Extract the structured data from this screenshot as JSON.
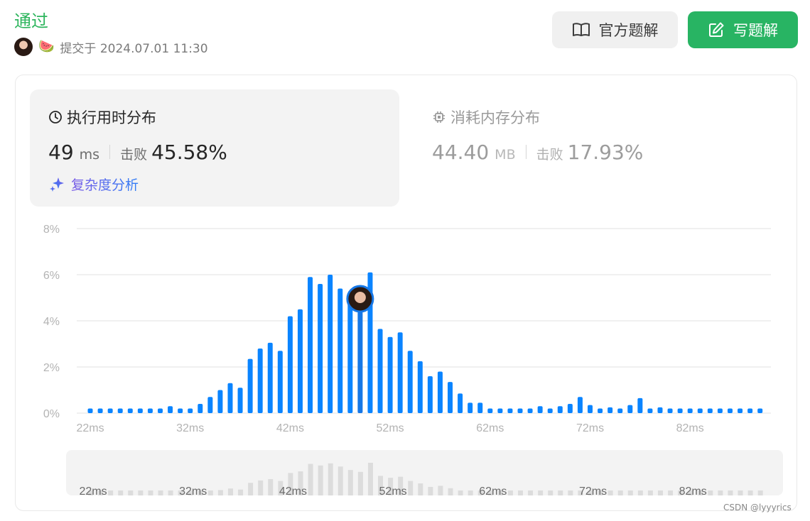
{
  "header": {
    "status": "通过",
    "submit_badge": "🍉",
    "submit_text": "提交于 2024.07.01 11:30"
  },
  "buttons": {
    "official_label": "官方题解",
    "write_label": "写题解"
  },
  "runtime": {
    "title": "执行用时分布",
    "value": "49",
    "unit": "ms",
    "beat_label": "击败",
    "beat_value": "45.58%",
    "complexity_label": "复杂度分析"
  },
  "memory": {
    "title": "消耗内存分布",
    "value": "44.40",
    "unit": "MB",
    "beat_label": "击败",
    "beat_value": "17.93%"
  },
  "watermark": "CSDN @lyyyrics",
  "colors": {
    "accept": "#2db55d",
    "bar": "#0a84ff",
    "bar_mini": "#dcdcdc",
    "write_button": "#28b463"
  },
  "chart_data": {
    "type": "bar",
    "x_unit": "ms",
    "x": [
      22,
      23,
      24,
      25,
      26,
      27,
      28,
      29,
      30,
      31,
      32,
      33,
      34,
      35,
      36,
      37,
      38,
      39,
      40,
      41,
      42,
      43,
      44,
      45,
      46,
      47,
      48,
      49,
      50,
      51,
      52,
      53,
      54,
      55,
      56,
      57,
      58,
      59,
      60,
      61,
      62,
      63,
      64,
      65,
      66,
      67,
      68,
      69,
      70,
      71,
      72,
      73,
      74,
      75,
      76,
      77,
      78,
      79,
      80,
      81,
      82,
      83,
      84,
      85,
      86,
      87,
      88,
      89
    ],
    "values": [
      0.2,
      0.2,
      0.2,
      0.2,
      0.2,
      0.2,
      0.2,
      0.2,
      0.3,
      0.2,
      0.2,
      0.4,
      0.7,
      1.0,
      1.3,
      1.1,
      2.35,
      2.8,
      3.05,
      2.7,
      4.2,
      4.5,
      5.9,
      5.6,
      6.0,
      5.4,
      4.75,
      4.4,
      6.1,
      3.65,
      3.3,
      3.5,
      2.7,
      2.25,
      1.6,
      1.8,
      1.35,
      0.85,
      0.45,
      0.45,
      0.2,
      0.2,
      0.2,
      0.2,
      0.2,
      0.3,
      0.2,
      0.3,
      0.4,
      0.7,
      0.35,
      0.2,
      0.25,
      0.2,
      0.35,
      0.65,
      0.2,
      0.25,
      0.2,
      0.2,
      0.2,
      0.2,
      0.2,
      0.2,
      0.2,
      0.2,
      0.2,
      0.2
    ],
    "highlight_x": 49,
    "y_ticks": [
      "0%",
      "2%",
      "4%",
      "6%",
      "8%"
    ],
    "ylim": [
      0,
      8
    ],
    "x_tick_labels": [
      "22ms",
      "32ms",
      "42ms",
      "52ms",
      "62ms",
      "72ms",
      "82ms"
    ],
    "grid": true
  }
}
